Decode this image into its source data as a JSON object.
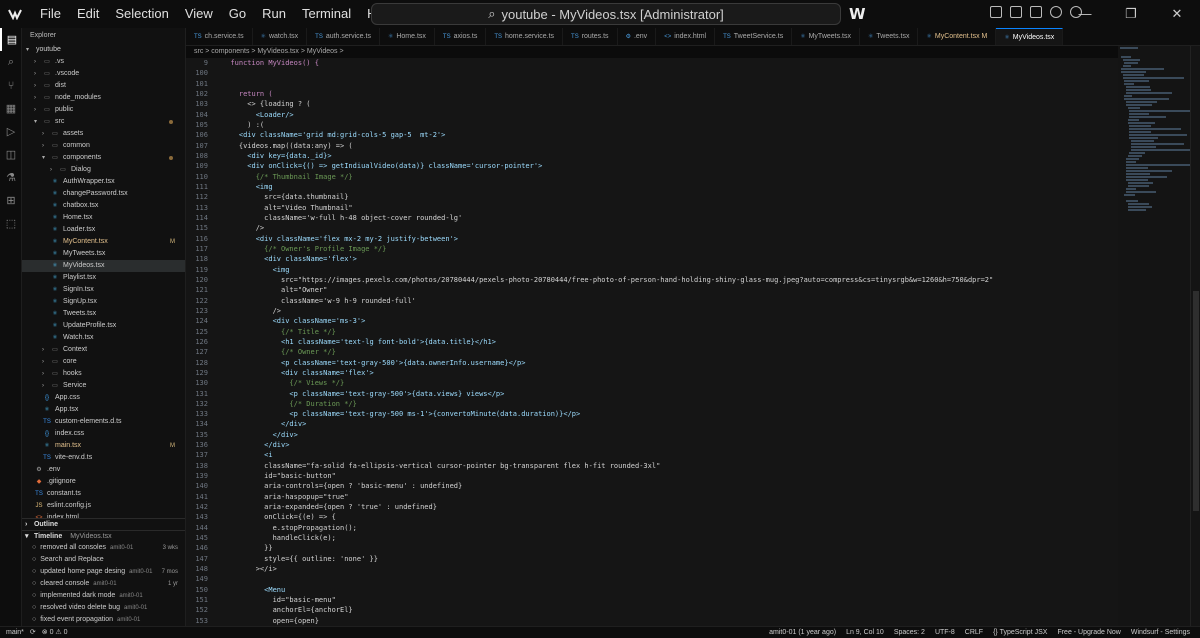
{
  "menu": [
    "File",
    "Edit",
    "Selection",
    "View",
    "Go",
    "Run",
    "Terminal",
    "Help"
  ],
  "search_text": "youtube - MyVideos.tsx [Administrator]",
  "sidebar": {
    "title": "Explorer",
    "root": "youtube",
    "tree": [
      {
        "label": ".vs",
        "kind": "folder",
        "depth": 1
      },
      {
        "label": ".vscode",
        "kind": "folder",
        "depth": 1
      },
      {
        "label": "dist",
        "kind": "folder",
        "depth": 1
      },
      {
        "label": "node_modules",
        "kind": "folder",
        "depth": 1
      },
      {
        "label": "public",
        "kind": "folder",
        "depth": 1
      },
      {
        "label": "src",
        "kind": "folder-open",
        "depth": 1,
        "dot": true
      },
      {
        "label": "assets",
        "kind": "folder",
        "depth": 2
      },
      {
        "label": "common",
        "kind": "folder",
        "depth": 2
      },
      {
        "label": "components",
        "kind": "folder-open",
        "depth": 2,
        "dot": true
      },
      {
        "label": "Dialog",
        "kind": "folder",
        "depth": 3
      },
      {
        "label": "AuthWrapper.tsx",
        "kind": "tsx",
        "depth": 3
      },
      {
        "label": "changePassword.tsx",
        "kind": "tsx",
        "depth": 3
      },
      {
        "label": "chatbox.tsx",
        "kind": "tsx",
        "depth": 3
      },
      {
        "label": "Home.tsx",
        "kind": "tsx",
        "depth": 3
      },
      {
        "label": "Loader.tsx",
        "kind": "tsx",
        "depth": 3
      },
      {
        "label": "MyContent.tsx",
        "kind": "tsx",
        "depth": 3,
        "badge": "M"
      },
      {
        "label": "MyTweets.tsx",
        "kind": "tsx",
        "depth": 3
      },
      {
        "label": "MyVideos.tsx",
        "kind": "tsx",
        "depth": 3,
        "selected": true
      },
      {
        "label": "Playlist.tsx",
        "kind": "tsx",
        "depth": 3
      },
      {
        "label": "SignIn.tsx",
        "kind": "tsx",
        "depth": 3
      },
      {
        "label": "SignUp.tsx",
        "kind": "tsx",
        "depth": 3
      },
      {
        "label": "Tweets.tsx",
        "kind": "tsx",
        "depth": 3
      },
      {
        "label": "UpdateProfile.tsx",
        "kind": "tsx",
        "depth": 3
      },
      {
        "label": "Watch.tsx",
        "kind": "tsx",
        "depth": 3
      },
      {
        "label": "Context",
        "kind": "folder",
        "depth": 2
      },
      {
        "label": "core",
        "kind": "folder",
        "depth": 2
      },
      {
        "label": "hooks",
        "kind": "folder",
        "depth": 2
      },
      {
        "label": "Service",
        "kind": "folder",
        "depth": 2
      },
      {
        "label": "App.css",
        "kind": "css",
        "depth": 2
      },
      {
        "label": "App.tsx",
        "kind": "tsx",
        "depth": 2
      },
      {
        "label": "custom-elements.d.ts",
        "kind": "ts",
        "depth": 2
      },
      {
        "label": "index.css",
        "kind": "css",
        "depth": 2
      },
      {
        "label": "main.tsx",
        "kind": "tsx",
        "depth": 2,
        "badge": "M"
      },
      {
        "label": "vite-env.d.ts",
        "kind": "ts",
        "depth": 2
      },
      {
        "label": ".env",
        "kind": "gear",
        "depth": 1
      },
      {
        "label": ".gitignore",
        "kind": "git",
        "depth": 1
      },
      {
        "label": "constant.ts",
        "kind": "ts",
        "depth": 1
      },
      {
        "label": "eslint.config.js",
        "kind": "js",
        "depth": 1
      },
      {
        "label": "index.html",
        "kind": "html",
        "depth": 1
      }
    ],
    "outline_label": "Outline",
    "timeline_label": "Timeline",
    "timeline_file": "MyVideos.tsx",
    "timeline": [
      {
        "msg": "removed all consoles",
        "who": "amit0-01",
        "when": "3 wks"
      },
      {
        "msg": "Search and Replace",
        "who": "",
        "when": ""
      },
      {
        "msg": "updated home page desing",
        "who": "amit0-01",
        "when": "7 mos"
      },
      {
        "msg": "cleared console",
        "who": "amit0-01",
        "when": "1 yr"
      },
      {
        "msg": "implemented dark mode",
        "who": "amit0-01",
        "when": ""
      },
      {
        "msg": "resolved video delete bug",
        "who": "amit0-01",
        "when": ""
      },
      {
        "msg": "fixed event propagation",
        "who": "amit0-01",
        "when": ""
      }
    ]
  },
  "tabs": [
    {
      "label": "ch.service.ts",
      "icon": "TS"
    },
    {
      "label": "watch.tsx",
      "icon": "⚛"
    },
    {
      "label": "auth.service.ts",
      "icon": "TS"
    },
    {
      "label": "Home.tsx",
      "icon": "⚛"
    },
    {
      "label": "axios.ts",
      "icon": "TS"
    },
    {
      "label": "home.service.ts",
      "icon": "TS"
    },
    {
      "label": "routes.ts",
      "icon": "TS"
    },
    {
      "label": ".env",
      "icon": "⚙"
    },
    {
      "label": "index.html",
      "icon": "<>"
    },
    {
      "label": "TweetService.ts",
      "icon": "TS"
    },
    {
      "label": "MyTweets.tsx",
      "icon": "⚛"
    },
    {
      "label": "Tweets.tsx",
      "icon": "⚛"
    },
    {
      "label": "MyContent.tsx M",
      "icon": "⚛",
      "modified": true
    },
    {
      "label": "MyVideos.tsx",
      "icon": "⚛",
      "active": true
    }
  ],
  "breadcrumb": "src > components > MyVideos.tsx > MyVideos >",
  "code": [
    {
      "n": "9",
      "t": "  function MyVideos() {"
    },
    {
      "n": "100",
      "t": ""
    },
    {
      "n": "101",
      "t": ""
    },
    {
      "n": "102",
      "t": "    return ("
    },
    {
      "n": "103",
      "t": "      <> {loading ? ("
    },
    {
      "n": "104",
      "t": "        <Loader/>"
    },
    {
      "n": "105",
      "t": "      ) :("
    },
    {
      "n": "106",
      "t": "    <div className='grid md:grid-cols-5 gap-5  mt-2'>"
    },
    {
      "n": "107",
      "t": "    {videos.map((data:any) => ("
    },
    {
      "n": "108",
      "t": "      <div key={data._id}>"
    },
    {
      "n": "109",
      "t": "      <div onClick={() => getIndiualVideo(data)} className='cursor-pointer'>"
    },
    {
      "n": "110",
      "t": "        {/* Thumbnail Image */}"
    },
    {
      "n": "111",
      "t": "        <img"
    },
    {
      "n": "112",
      "t": "          src={data.thumbnail}"
    },
    {
      "n": "113",
      "t": "          alt=\"Video Thumbnail\""
    },
    {
      "n": "114",
      "t": "          className='w-full h-48 object-cover rounded-lg'"
    },
    {
      "n": "115",
      "t": "        />"
    },
    {
      "n": "116",
      "t": "        <div className='flex mx-2 my-2 justify-between'>"
    },
    {
      "n": "117",
      "t": "          {/* Owner's Profile Image */}"
    },
    {
      "n": "118",
      "t": "          <div className='flex'>"
    },
    {
      "n": "119",
      "t": "            <img"
    },
    {
      "n": "120",
      "t": "              src=\"https://images.pexels.com/photos/20780444/pexels-photo-20780444/free-photo-of-person-hand-holding-shiny-glass-mug.jpeg?auto=compress&cs=tinysrgb&w=1260&h=750&dpr=2\""
    },
    {
      "n": "121",
      "t": "              alt=\"Owner\""
    },
    {
      "n": "122",
      "t": "              className='w-9 h-9 rounded-full'"
    },
    {
      "n": "123",
      "t": "            />"
    },
    {
      "n": "124",
      "t": "            <div className='ms-3'>"
    },
    {
      "n": "125",
      "t": "              {/* Title */}"
    },
    {
      "n": "126",
      "t": "              <h1 className='text-lg font-bold'>{data.title}</h1>"
    },
    {
      "n": "127",
      "t": "              {/* Owner */}"
    },
    {
      "n": "128",
      "t": "              <p className='text-gray-500'>{data.ownerInfo.username}</p>"
    },
    {
      "n": "129",
      "t": "              <div className='flex'>"
    },
    {
      "n": "130",
      "t": "                {/* Views */}"
    },
    {
      "n": "131",
      "t": "                <p className='text-gray-500'>{data.views} views</p>"
    },
    {
      "n": "132",
      "t": "                {/* Duration */}"
    },
    {
      "n": "133",
      "t": "                <p className='text-gray-500 ms-1'>{convertoMinute(data.duration)}</p>"
    },
    {
      "n": "134",
      "t": "              </div>"
    },
    {
      "n": "135",
      "t": "            </div>"
    },
    {
      "n": "136",
      "t": "          </div>"
    },
    {
      "n": "137",
      "t": "          <i"
    },
    {
      "n": "138",
      "t": "          className=\"fa-solid fa-ellipsis-vertical cursor-pointer bg-transparent flex h-fit rounded-3xl\""
    },
    {
      "n": "139",
      "t": "          id=\"basic-button\""
    },
    {
      "n": "140",
      "t": "          aria-controls={open ? 'basic-menu' : undefined}"
    },
    {
      "n": "141",
      "t": "          aria-haspopup=\"true\""
    },
    {
      "n": "142",
      "t": "          aria-expanded={open ? 'true' : undefined}"
    },
    {
      "n": "143",
      "t": "          onClick={(e) => {"
    },
    {
      "n": "144",
      "t": "            e.stopPropagation();"
    },
    {
      "n": "145",
      "t": "            handleClick(e);"
    },
    {
      "n": "146",
      "t": "          }}"
    },
    {
      "n": "147",
      "t": "          style={{ outline: 'none' }}"
    },
    {
      "n": "148",
      "t": "        ></i>"
    },
    {
      "n": "149",
      "t": ""
    },
    {
      "n": "150",
      "t": "          <Menu"
    },
    {
      "n": "151",
      "t": "            id=\"basic-menu\""
    },
    {
      "n": "152",
      "t": "            anchorEl={anchorEl}"
    },
    {
      "n": "153",
      "t": "            open={open}"
    }
  ],
  "status": {
    "branch": "main*",
    "sync": "⟳",
    "problems": "⊗ 0  ⚠ 0",
    "blame": "amit0-01 (1 year ago)",
    "position": "Ln 9, Col 10",
    "spaces": "Spaces: 2",
    "encoding": "UTF-8",
    "eol": "CRLF",
    "language": "{} TypeScript JSX",
    "plan": "Free - Upgrade Now",
    "settings": "Windsurf - Settings"
  }
}
